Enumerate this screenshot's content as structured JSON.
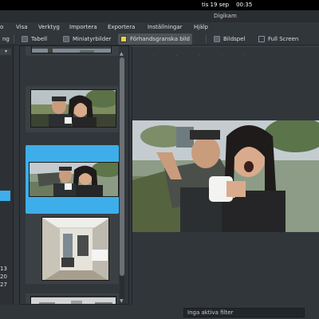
{
  "system": {
    "date": "tis 19 sep",
    "time": "00:35"
  },
  "window": {
    "title": "Digikam"
  },
  "menu": [
    "o",
    "Visa",
    "Verktyg",
    "Importera",
    "Exportera",
    "Inställningar",
    "Hjälp"
  ],
  "toolbar": {
    "partial_label": "ng",
    "items": [
      {
        "label": "Tabell",
        "icon": "table-icon",
        "active": false
      },
      {
        "label": "Miniatyrbilder",
        "icon": "thumbnails-icon",
        "active": false
      },
      {
        "label": "Förhandsgranska bild",
        "icon": "preview-image-icon",
        "active": true
      },
      {
        "label": "Bildspel",
        "icon": "slideshow-icon",
        "active": false
      },
      {
        "label": "Full Screen",
        "icon": "fullscreen-icon",
        "active": false
      }
    ]
  },
  "left_panel": {
    "dates": [
      "13",
      "20",
      "27"
    ]
  },
  "thumbnails": [
    {
      "name": "photo-street",
      "selected": false
    },
    {
      "name": "photo-couple-coffee",
      "selected": false
    },
    {
      "name": "photo-couple-coffee-selected",
      "selected": true
    },
    {
      "name": "photo-hallway-room",
      "selected": false
    },
    {
      "name": "photo-street-2",
      "selected": false
    }
  ],
  "status": {
    "filter_label": "Inga aktiva filter"
  },
  "colors": {
    "accent": "#3daee9",
    "background": "#31363b"
  }
}
